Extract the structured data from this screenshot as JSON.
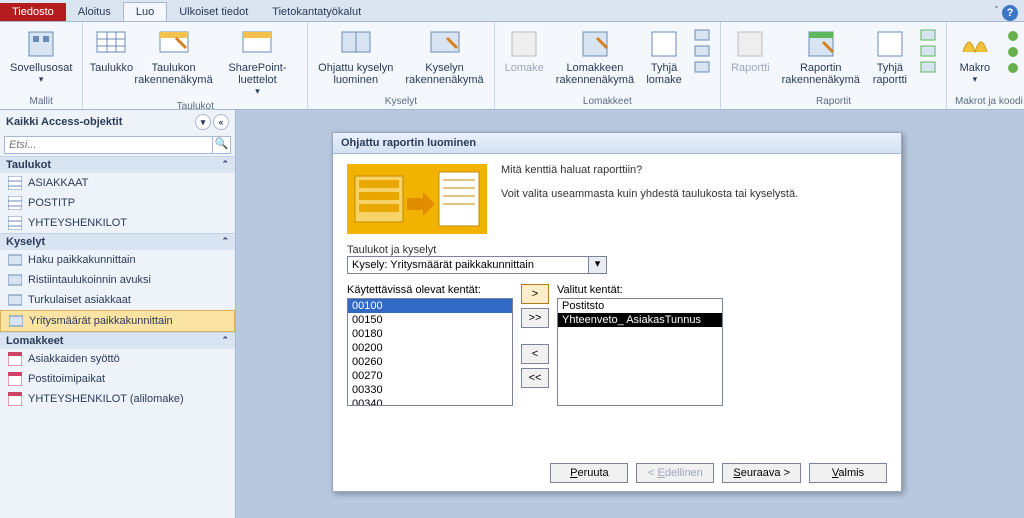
{
  "tabs": {
    "file": "Tiedosto",
    "home": "Aloitus",
    "create": "Luo",
    "external": "Ulkoiset tiedot",
    "dbtools": "Tietokantatyökalut"
  },
  "ribbon": {
    "groups": {
      "mallit": {
        "label": "Mallit",
        "items": [
          {
            "label": "Sovellusosat"
          }
        ]
      },
      "taulukot": {
        "label": "Taulukot",
        "items": [
          {
            "label": "Taulukko"
          },
          {
            "label": "Taulukon\nrakennenäkymä"
          },
          {
            "label": "SharePoint-luettelot"
          }
        ]
      },
      "kyselyt": {
        "label": "Kyselyt",
        "items": [
          {
            "label": "Ohjattu kyselyn\nluominen"
          },
          {
            "label": "Kyselyn\nrakennenäkymä"
          }
        ]
      },
      "lomakkeet": {
        "label": "Lomakkeet",
        "items": [
          {
            "label": "Lomake",
            "disabled": true
          },
          {
            "label": "Lomakkeen\nrakennenäkymä"
          },
          {
            "label": "Tyhjä\nlomake"
          }
        ]
      },
      "raportit": {
        "label": "Raportit",
        "items": [
          {
            "label": "Raportti",
            "disabled": true
          },
          {
            "label": "Raportin\nrakennenäkymä"
          },
          {
            "label": "Tyhjä\nraportti"
          }
        ]
      },
      "makrot": {
        "label": "Makrot ja koodi",
        "items": [
          {
            "label": "Makro"
          }
        ]
      }
    }
  },
  "nav": {
    "title": "Kaikki Access-objektit",
    "search_placeholder": "Etsi...",
    "sections": {
      "taulukot": {
        "label": "Taulukot",
        "items": [
          "ASIAKKAAT",
          "POSTITP",
          "YHTEYSHENKILOT"
        ]
      },
      "kyselyt": {
        "label": "Kyselyt",
        "items": [
          "Haku paikkakunnittain",
          "Ristiintaulukoinnin avuksi",
          "Turkulaiset asiakkaat",
          "Yritysmäärät paikkakunnittain"
        ],
        "selected": 3
      },
      "lomakkeet": {
        "label": "Lomakkeet",
        "items": [
          "Asiakkaiden syöttö",
          "Postitoimipaikat",
          "YHTEYSHENKILOT (alilomake)"
        ]
      }
    }
  },
  "dialog": {
    "title": "Ohjattu raportin luominen",
    "q": "Mitä kenttiä haluat raporttiin?",
    "hint": "Voit valita useammasta kuin yhdestä taulukosta tai kyselystä.",
    "src_label": "Taulukot ja kyselyt",
    "src_value": "Kysely: Yritysmäärät paikkakunnittain",
    "avail_label": "Käytettävissä olevat kentät:",
    "sel_label": "Valitut kentät:",
    "avail": [
      "00100",
      "00150",
      "00180",
      "00200",
      "00260",
      "00270",
      "00330",
      "00340"
    ],
    "selected": [
      "Postitsto",
      "Yhteenveto_ AsiakasTunnus"
    ],
    "buttons": {
      "add": ">",
      "addall": ">>",
      "remove": "<",
      "removeall": "<<"
    },
    "nav": {
      "cancel": "Peruuta",
      "back": "< Edellinen",
      "next": "Seuraava >",
      "finish": "Valmis"
    },
    "underline": {
      "src": "T",
      "cancel": "P",
      "back": "E",
      "next": "S",
      "finish": "V"
    }
  }
}
